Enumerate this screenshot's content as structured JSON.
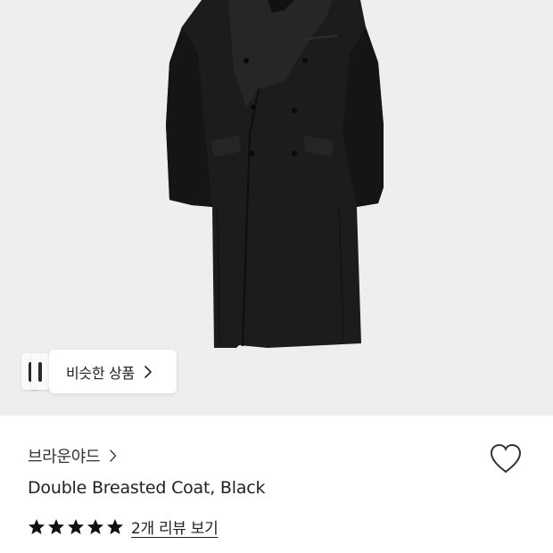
{
  "product": {
    "similar_label": "비슷한 상품",
    "brand": "브라운야드",
    "title": "Double Breasted Coat, Black",
    "rating": 5,
    "rating_max": 5,
    "reviews_label": "2개 리뷰 보기"
  },
  "icons": {
    "chevron": "chevron-right-icon",
    "wishlist": "heart-outline-icon",
    "star": "star-filled-icon"
  },
  "colors": {
    "hero_background": "#eeeeee",
    "coat": "#1c1c1c",
    "text": "#222222",
    "star": "#111111"
  }
}
